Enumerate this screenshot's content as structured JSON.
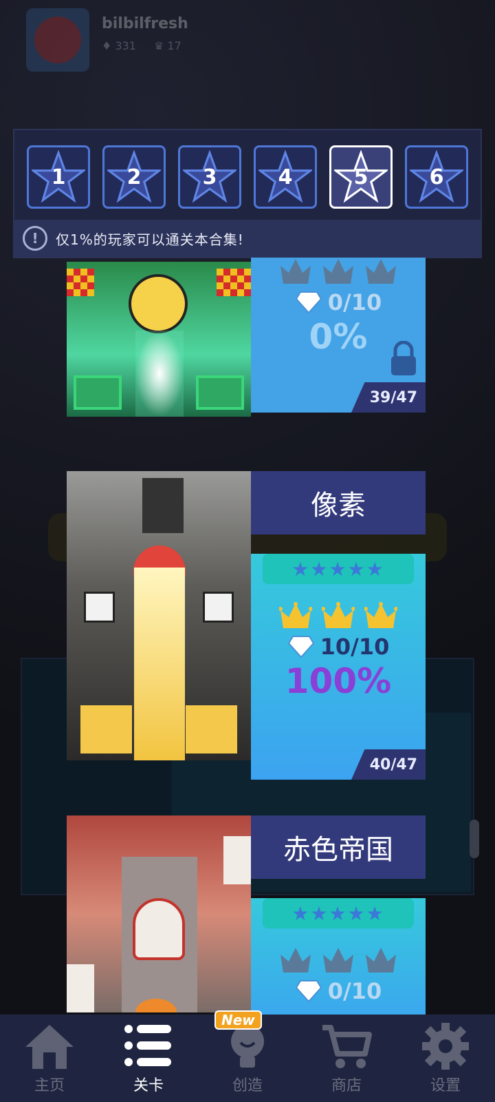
{
  "profile": {
    "username": "bilbilfresh",
    "gems": "331",
    "crowns": "17"
  },
  "star_tabs": [
    {
      "label": "1",
      "selected": false
    },
    {
      "label": "2",
      "selected": false
    },
    {
      "label": "3",
      "selected": false
    },
    {
      "label": "4",
      "selected": false
    },
    {
      "label": "5",
      "selected": true
    },
    {
      "label": "6",
      "selected": false
    }
  ],
  "notice": {
    "icon": "info-icon",
    "text": "仅1%的玩家可以通关本合集!"
  },
  "levels": [
    {
      "title": "",
      "crowns_earned": 0,
      "gems": "0/10",
      "percent": "0%",
      "progress": "39/47",
      "locked": true
    },
    {
      "title": "像素",
      "stars": "★★★★★",
      "crowns_earned": 3,
      "gems": "10/10",
      "percent": "100%",
      "progress": "40/47",
      "locked": false
    },
    {
      "title": "赤色帝国",
      "stars": "★★★★★",
      "crowns_earned": 0,
      "gems": "0/10",
      "locked": false
    }
  ],
  "nav": {
    "items": [
      {
        "label": "主页",
        "icon": "home-icon",
        "active": false
      },
      {
        "label": "关卡",
        "icon": "list-icon",
        "active": true
      },
      {
        "label": "创造",
        "icon": "lightbulb-icon",
        "active": false,
        "badge": "New"
      },
      {
        "label": "商店",
        "icon": "cart-icon",
        "active": false
      },
      {
        "label": "设置",
        "icon": "gear-icon",
        "active": false
      }
    ]
  },
  "colors": {
    "panel": "#1f2540",
    "tab_border": "#4f77d8",
    "card_blue": "#44a2e6",
    "gold": "#f5c330",
    "purple_pct": "#8a3fd6"
  }
}
